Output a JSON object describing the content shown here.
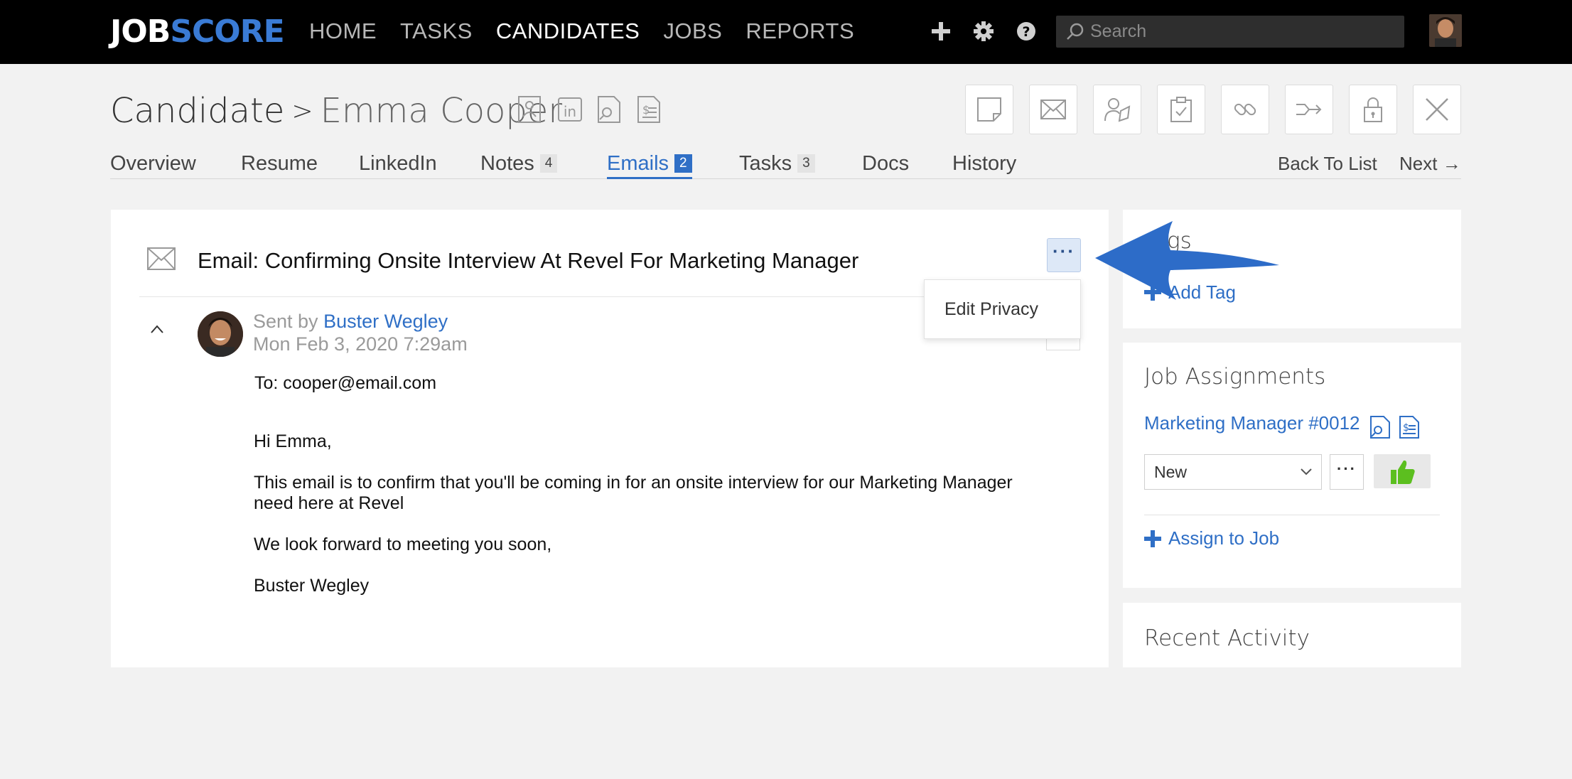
{
  "brand": {
    "logo_part1": "JOB",
    "logo_part2": "SCORE"
  },
  "nav": {
    "items": [
      "HOME",
      "TASKS",
      "CANDIDATES",
      "JOBS",
      "REPORTS"
    ],
    "active": "CANDIDATES",
    "icons": [
      "plus-icon",
      "gear-icon",
      "help-icon"
    ]
  },
  "search": {
    "placeholder": "Search"
  },
  "header": {
    "crumb_root": "Candidate",
    "separator": ">",
    "candidate_name": "Emma Cooper",
    "profile_icons": [
      "resume-icon",
      "linkedin-icon",
      "search-doc-icon",
      "salary-doc-icon"
    ],
    "action_icons": [
      "note-icon",
      "email-icon",
      "refer-icon",
      "task-icon",
      "link-icon",
      "share-icon",
      "lock-icon",
      "close-icon"
    ]
  },
  "tabs": [
    {
      "label": "Overview"
    },
    {
      "label": "Resume"
    },
    {
      "label": "LinkedIn"
    },
    {
      "label": "Notes",
      "count": "4"
    },
    {
      "label": "Emails",
      "count": "2",
      "active": true
    },
    {
      "label": "Tasks",
      "count": "3"
    },
    {
      "label": "Docs"
    },
    {
      "label": "History"
    }
  ],
  "tab_nav": {
    "back": "Back To List",
    "next": "Next",
    "next_arrow": "→"
  },
  "email": {
    "title": "Email: Confirming Onsite Interview At Revel For Marketing Manager",
    "more_label": "···",
    "sent_by_prefix": "Sent by",
    "sender": "Buster Wegley",
    "date": "Mon Feb 3, 2020 7:29am",
    "to": "To: cooper@email.com",
    "body": [
      "Hi Emma,",
      "This email is to confirm that you'll be coming in for an onsite interview for our Marketing Manager need here at Revel",
      "We look forward to meeting you soon,",
      "Buster Wegley"
    ]
  },
  "dropdown": {
    "items": [
      "Edit Privacy"
    ]
  },
  "sidebar": {
    "tags": {
      "title_visible": "gs",
      "add_tag": "Add Tag"
    },
    "jobs": {
      "title": "Job Assignments",
      "job_link": "Marketing Manager #0012",
      "status": "New",
      "more_label": "···",
      "assign": "Assign to Job"
    },
    "recent": {
      "title": "Recent Activity"
    }
  },
  "colors": {
    "brand_blue": "#2f6fc6",
    "thumb_green": "#5cbf1f",
    "annotation_arrow": "#2d6cc8"
  }
}
